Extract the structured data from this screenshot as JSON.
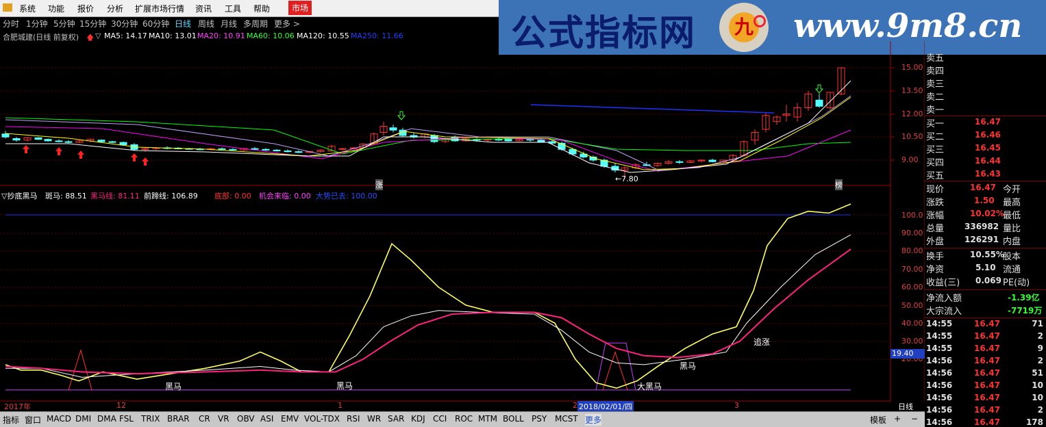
{
  "menu": {
    "items": [
      "系统",
      "功能",
      "报价",
      "分析",
      "扩展市场行情",
      "资讯",
      "工具",
      "帮助"
    ],
    "market": "市场"
  },
  "banner": {
    "title": "公式指标网",
    "url": "www.9m8.cn",
    "logo_text": "九",
    "logo_sub": "www.9m8.cn"
  },
  "periods": [
    "分时",
    "1分钟",
    "5分钟",
    "15分钟",
    "30分钟",
    "60分钟",
    "日线",
    "周线",
    "月线",
    "多周期",
    "更多 >"
  ],
  "active_period": "日线",
  "stock": {
    "title": "合肥城建(日线 前复权)",
    "ma5": "MA5: 14.17",
    "ma10": "MA10: 13.01",
    "ma20": "MA20: 10.91",
    "ma60": "MA60: 10.06",
    "ma120": "MA120: 10.55",
    "ma250": "MA250: 11.66"
  },
  "indicator": {
    "name": "▽抄底黑马",
    "zebra": "斑马: 88.51",
    "black_horse": "黑马线: 81.11",
    "prev_fall": "前蹄线: 106.89",
    "bottom": "底部: 0.00",
    "chance": "机会来临: 0.00",
    "trend": "大势已去: 100.00"
  },
  "price_axis": [
    "15.00",
    "13.50",
    "12.00",
    "10.50",
    "9.00"
  ],
  "ind_axis": [
    "100.0",
    "90.00",
    "80.00",
    "70.00",
    "60.00",
    "50.00",
    "40.00",
    "30.00",
    "20.00"
  ],
  "cursor_value": "19.40",
  "chart_marks": {
    "low_label": "←7.80",
    "zhang": "涨",
    "bang": "榜"
  },
  "annotations": [
    "黑马",
    "黑马",
    "大黑马",
    "黑马",
    "追涨"
  ],
  "date_axis": [
    "2017年",
    "12",
    "1",
    "2",
    "3"
  ],
  "cursor_date": "2018/02/01/四",
  "timeframe_label": "日线",
  "quotes": {
    "sell": [
      "卖五",
      "卖四",
      "卖三",
      "卖二",
      "卖一"
    ],
    "buy": [
      {
        "label": "买一",
        "price": "16.47"
      },
      {
        "label": "买二",
        "price": "16.46"
      },
      {
        "label": "买三",
        "price": "16.45"
      },
      {
        "label": "买四",
        "price": "16.44"
      },
      {
        "label": "买五",
        "price": "16.43"
      }
    ]
  },
  "stats": [
    {
      "label": "现价",
      "value": "16.47",
      "label2": "今开"
    },
    {
      "label": "涨跌",
      "value": "1.50",
      "label2": "最高"
    },
    {
      "label": "涨幅",
      "value": "10.02%",
      "label2": "最低"
    },
    {
      "label": "总量",
      "value": "336982",
      "label2": "量比"
    },
    {
      "label": "外盘",
      "value": "126291",
      "label2": "内盘"
    },
    {
      "label": "换手",
      "value": "10.55%",
      "label2": "股本"
    },
    {
      "label": "净资",
      "value": "5.10",
      "label2": "流通"
    },
    {
      "label": "收益(三)",
      "value": "0.069",
      "label2": "PE(动)"
    }
  ],
  "flows": [
    {
      "label": "净流入额",
      "value": "-1.39亿"
    },
    {
      "label": "大宗流入",
      "value": "-7719万"
    }
  ],
  "ticks": [
    {
      "time": "14:55",
      "price": "16.47",
      "vol": "71"
    },
    {
      "time": "14:55",
      "price": "16.47",
      "vol": "2"
    },
    {
      "time": "14:55",
      "price": "16.47",
      "vol": "9"
    },
    {
      "time": "14:56",
      "price": "16.47",
      "vol": "2"
    },
    {
      "time": "14:56",
      "price": "16.47",
      "vol": "51"
    },
    {
      "time": "14:56",
      "price": "16.47",
      "vol": "10"
    },
    {
      "time": "14:56",
      "price": "16.47",
      "vol": "10"
    },
    {
      "time": "14:56",
      "price": "16.47",
      "vol": "2"
    },
    {
      "time": "14:56",
      "price": "16.47",
      "vol": "178"
    }
  ],
  "bottom_tabs": [
    "指标",
    "窗口",
    "MACD",
    "DMI",
    "DMA",
    "FSL",
    "TRIX",
    "BRAR",
    "CR",
    "VR",
    "OBV",
    "ASI",
    "EMV",
    "VOL-TDX",
    "RSI",
    "WR",
    "SAR",
    "KDJ",
    "CCI",
    "ROC",
    "MTM",
    "BOLL",
    "PSY",
    "MCST",
    "更多"
  ],
  "bottom_right": [
    "模板",
    "+",
    "−"
  ],
  "colors": {
    "up": "#ff3232",
    "down": "#54ffff",
    "ma5": "#ffffff",
    "ma10": "#ffff00",
    "ma20": "#ff00ff",
    "ma60": "#00ff00",
    "ma120": "#ffffff",
    "ma250": "#2030ff",
    "zebra": "#ffff60",
    "black_horse": "#ff2080",
    "prev_fall": "#ffffff"
  }
}
